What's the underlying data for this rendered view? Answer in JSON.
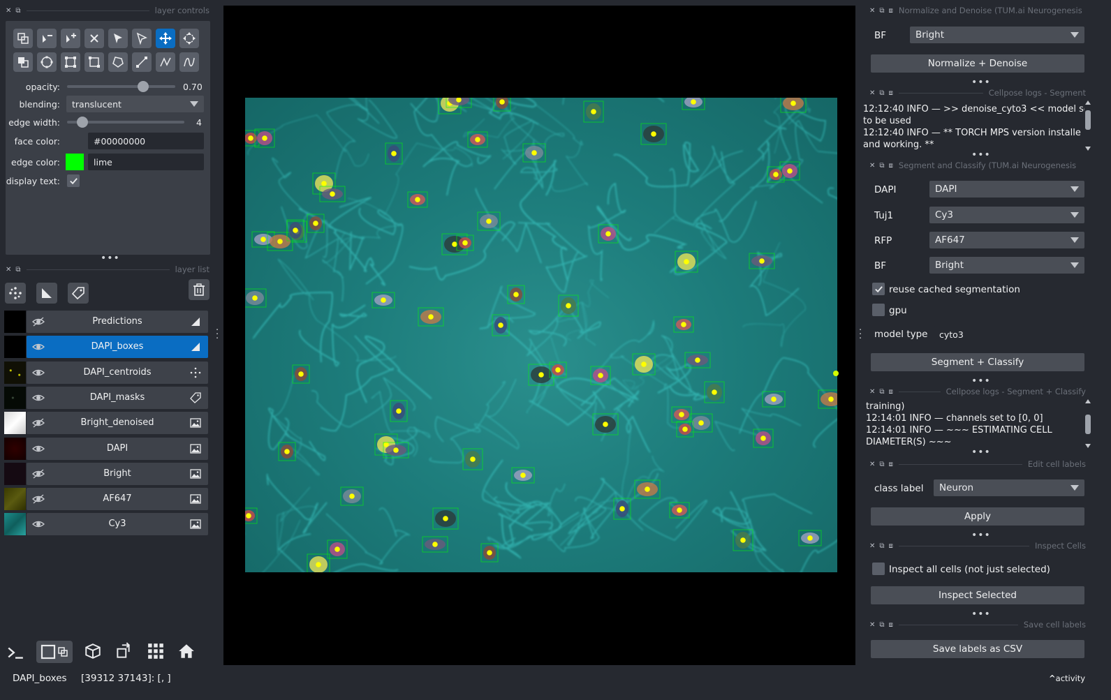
{
  "layer_controls": {
    "title": "layer controls",
    "opacity_label": "opacity:",
    "opacity_value": "0.70",
    "opacity_fraction": 0.7,
    "blending_label": "blending:",
    "blending_value": "translucent",
    "edge_width_label": "edge width:",
    "edge_width_value": "4",
    "face_color_label": "face color:",
    "face_color_value": "#00000000",
    "edge_color_label": "edge color:",
    "edge_color_value": "lime",
    "edge_color_hex": "#00ff00",
    "display_text_label": "display text:",
    "display_text_checked": true
  },
  "layer_list": {
    "title": "layer list",
    "layers": [
      {
        "name": "Predictions",
        "type": "shapes-icon",
        "visible": false,
        "selected": false
      },
      {
        "name": "DAPI_boxes",
        "type": "shapes-icon",
        "visible": true,
        "selected": true
      },
      {
        "name": "DAPI_centroids",
        "type": "points-icon",
        "visible": true,
        "selected": false
      },
      {
        "name": "DAPI_masks",
        "type": "labels-icon",
        "visible": true,
        "selected": false
      },
      {
        "name": "Bright_denoised",
        "type": "image-icon",
        "visible": false,
        "selected": false
      },
      {
        "name": "DAPI",
        "type": "image-icon",
        "visible": true,
        "selected": false
      },
      {
        "name": "Bright",
        "type": "image-icon",
        "visible": false,
        "selected": false
      },
      {
        "name": "AF647",
        "type": "image-icon",
        "visible": false,
        "selected": false
      },
      {
        "name": "Cy3",
        "type": "image-icon",
        "visible": true,
        "selected": false
      }
    ]
  },
  "normalize": {
    "title": "Normalize and Denoise (TUM.ai Neurogenesis",
    "bf_label": "BF",
    "bf_value": "Bright",
    "button": "Normalize + Denoise"
  },
  "cellpose_log_1": {
    "title": "Cellpose logs - Segment",
    "lines": [
      "12:12:40 INFO — >> denoise_cyto3 << model se",
      "to be used",
      "12:12:40 INFO — ** TORCH MPS version installe",
      "and working. **"
    ]
  },
  "segment": {
    "title": "Segment and Classify (TUM.ai Neurogenesis",
    "dapi_label": "DAPI",
    "dapi_value": "DAPI",
    "tuj1_label": "Tuj1",
    "tuj1_value": "Cy3",
    "rfp_label": "RFP",
    "rfp_value": "AF647",
    "bf_label": "BF",
    "bf_value": "Bright",
    "reuse_label": "reuse cached segmentation",
    "reuse_checked": true,
    "gpu_label": "gpu",
    "gpu_checked": false,
    "model_type_label": "model type",
    "model_type_value": "cyto3",
    "button": "Segment + Classify"
  },
  "cellpose_log_2": {
    "title": "Cellpose logs - Segment + Classify",
    "lines": [
      "training)",
      "12:14:01 INFO — channels set to [0, 0]",
      "12:14:01 INFO — ~~~ ESTIMATING CELL",
      "DIAMETER(S) ~~~"
    ]
  },
  "edit_labels": {
    "title": "Edit cell labels",
    "class_label": "class label",
    "class_value": "Neuron",
    "button": "Apply"
  },
  "inspect": {
    "title": "Inspect Cells",
    "checkbox_label": "Inspect all cells (not just selected)",
    "checked": false,
    "button": "Inspect Selected"
  },
  "save": {
    "title": "Save cell labels",
    "button": "Save labels as CSV"
  },
  "status": {
    "layer": "DAPI_boxes",
    "coords": "[39312 37143]: [, ]",
    "activity": "activity"
  },
  "colors": {
    "accent": "#0a6dc2",
    "background": "#262930",
    "panel": "#3b3f47",
    "box_edge": "#00ff00",
    "centroid": "#ffff00",
    "image_teal": "#1d7c7b"
  }
}
